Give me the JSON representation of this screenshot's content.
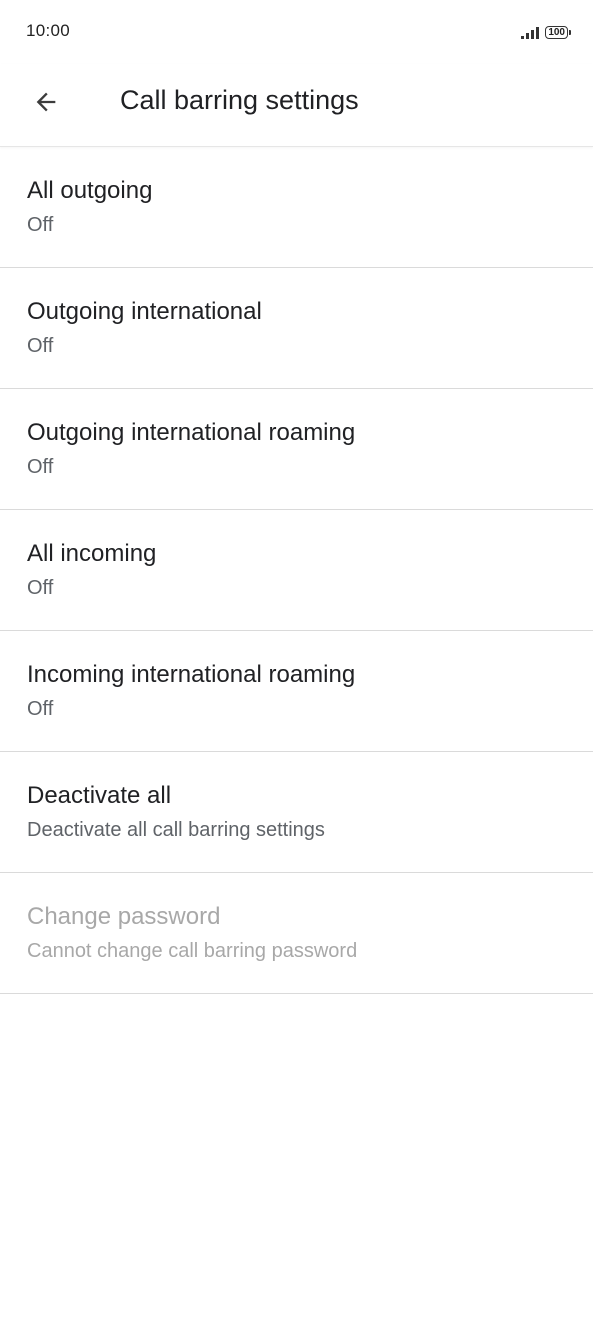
{
  "status_bar": {
    "time": "10:00",
    "battery": "100"
  },
  "header": {
    "title": "Call barring settings",
    "back_icon": "arrow-back-icon"
  },
  "items": [
    {
      "title": "All outgoing",
      "summary": "Off",
      "enabled": true
    },
    {
      "title": "Outgoing international",
      "summary": "Off",
      "enabled": true
    },
    {
      "title": "Outgoing international roaming",
      "summary": "Off",
      "enabled": true
    },
    {
      "title": "All incoming",
      "summary": "Off",
      "enabled": true
    },
    {
      "title": "Incoming international roaming",
      "summary": "Off",
      "enabled": true
    },
    {
      "title": "Deactivate all",
      "summary": "Deactivate all call barring settings",
      "enabled": true
    },
    {
      "title": "Change password",
      "summary": "Cannot change call barring password",
      "enabled": false
    }
  ],
  "colors": {
    "title_text": "#202124",
    "summary_text": "#5f6368",
    "disabled_text": "#a8a8a8",
    "divider": "#dadada"
  }
}
